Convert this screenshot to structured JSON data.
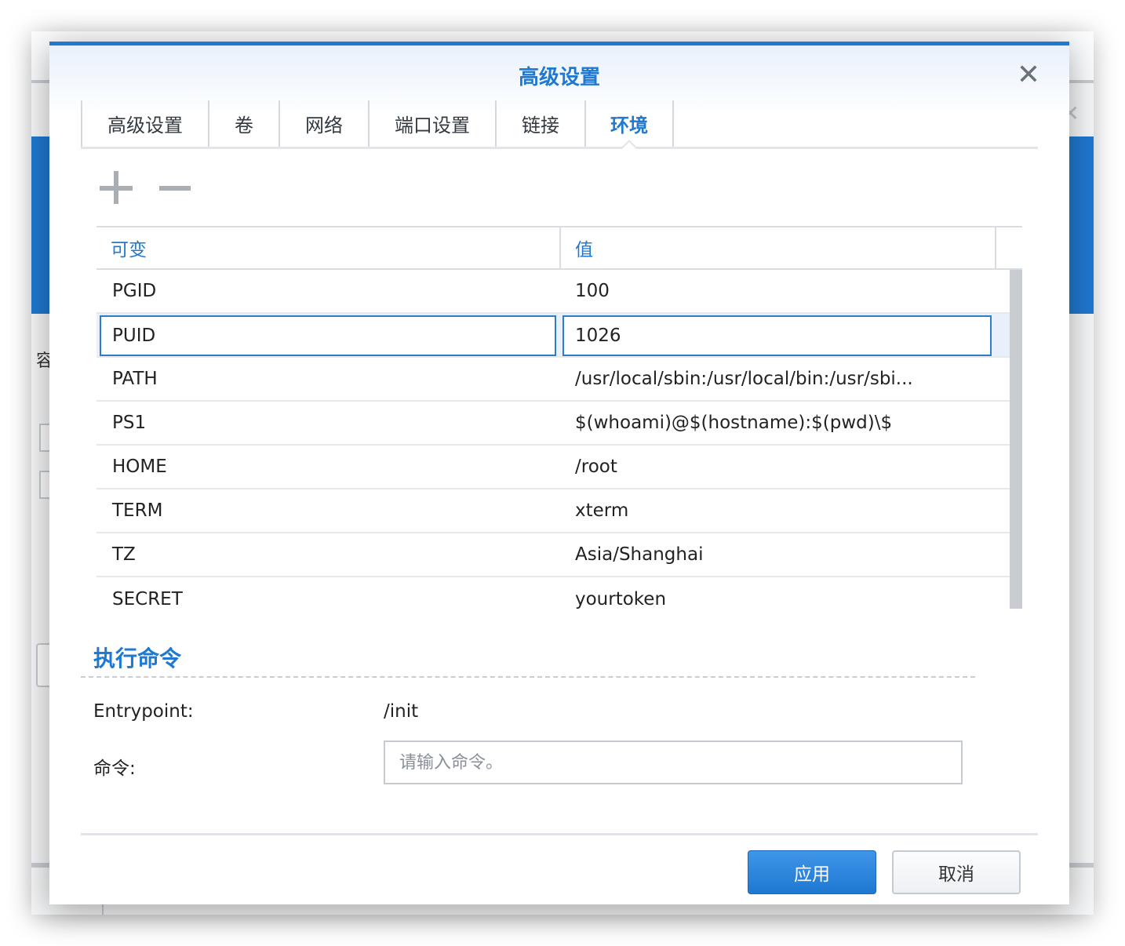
{
  "dialog": {
    "title": "高级设置",
    "close_symbol": "✕"
  },
  "tabs": [
    {
      "label": "高级设置"
    },
    {
      "label": "卷"
    },
    {
      "label": "网络"
    },
    {
      "label": "端口设置"
    },
    {
      "label": "链接"
    },
    {
      "label": "环境",
      "active": true
    }
  ],
  "toolbar": {
    "add_icon": "plus-icon",
    "remove_icon": "minus-icon"
  },
  "env_table": {
    "headers": {
      "variable": "可变",
      "value": "值"
    },
    "rows": [
      {
        "name": "PGID",
        "value": "100"
      },
      {
        "name": "PUID",
        "value": "1026",
        "selected": true
      },
      {
        "name": "PATH",
        "value": "/usr/local/sbin:/usr/local/bin:/usr/sbi..."
      },
      {
        "name": "PS1",
        "value": "$(whoami)@$(hostname):$(pwd)\\$"
      },
      {
        "name": "HOME",
        "value": "/root"
      },
      {
        "name": "TERM",
        "value": "xterm"
      },
      {
        "name": "TZ",
        "value": "Asia/Shanghai"
      },
      {
        "name": "SECRET",
        "value": "yourtoken"
      }
    ]
  },
  "exec": {
    "section_title": "执行命令",
    "entrypoint_label": "Entrypoint:",
    "entrypoint_value": "/init",
    "command_label": "命令:",
    "command_value": "",
    "command_placeholder": "请输入命令。"
  },
  "buttons": {
    "apply": "应用",
    "cancel": "取消"
  },
  "background_window": {
    "label_fragment": "容"
  },
  "colors": {
    "accent": "#1f78d1",
    "selection_border": "#2c7cc9"
  }
}
